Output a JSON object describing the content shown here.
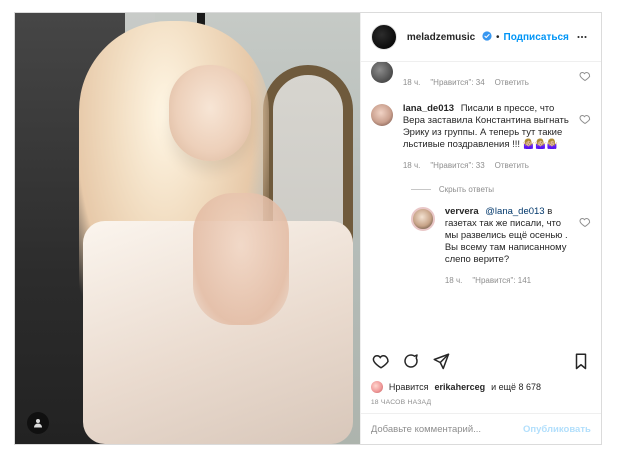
{
  "post": {
    "header": {
      "username": "meladzemusic",
      "separator": "•",
      "follow_label": "Подписаться"
    },
    "comments": {
      "top_partial": {
        "time": "18 ч.",
        "likes": "\"Нравится\": 34",
        "reply_label": "Ответить"
      },
      "main": {
        "username": "lana_de013",
        "text": "Писали в прессе, что Вера заставила Константина выгнать Эрику из группы. А теперь тут такие льстивые поздравления !!! 🤷🏼‍♀️🤷🏼‍♀️🤷🏼‍♀️",
        "time": "18 ч.",
        "likes": "\"Нравится\": 33",
        "reply_label": "Ответить"
      },
      "hide_replies_label": "Скрыть ответы",
      "reply": {
        "username": "ververa",
        "mention": "@lana_de013",
        "text": "в газетах так же писали, что мы развелись ещё осенью . Вы всему там написанному слепо верите?",
        "time": "18 ч.",
        "likes": "\"Нравится\": 141"
      }
    },
    "likes_line": {
      "prefix": "Нравится",
      "user": "erikaherceg",
      "suffix": "и ещё 8 678"
    },
    "timestamp": "18 ЧАСОВ НАЗАД",
    "comment_box": {
      "placeholder": "Добавьте комментарий...",
      "post_label": "Опубликовать"
    }
  },
  "icons": {
    "verified": "verified-badge-icon",
    "more": "more-options-icon",
    "heart": "heart-outline-icon",
    "comment": "comment-bubble-icon",
    "share": "share-paper-plane-icon",
    "bookmark": "bookmark-outline-icon",
    "user_tag": "user-tag-icon"
  },
  "colors": {
    "accent": "#0095f6",
    "muted": "#8e8e8e",
    "border": "#efefef",
    "text": "#262626",
    "disabled_post": "#b2dffc"
  }
}
